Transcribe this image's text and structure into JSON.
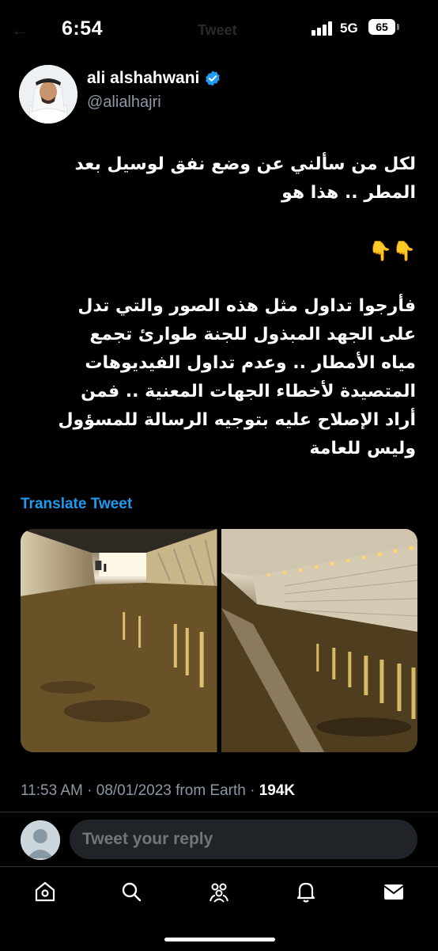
{
  "status_bar": {
    "time": "6:54",
    "network": "5G",
    "battery": "65",
    "header_ghost": "Tweet"
  },
  "author": {
    "name": "ali alshahwani",
    "handle": "@alialhajri",
    "verified": true
  },
  "tweet": {
    "paragraph1": [
      "لكل من سألني عن وضع نفق لوسيل بعد",
      "المطر .. هذا هو"
    ],
    "emoji": "👇👇",
    "paragraph2": [
      "فأرجوا تداول مثل هذه الصور والتي تدل",
      "على الجهد المبذول للجنة طوارئ تجمع",
      "مياه الأمطار .. وعدم تداول الفيديوهات",
      "المتصيدة لأخطاء الجهات المعنية .. فمن",
      "أراد الإصلاح عليه بتوجيه الرسالة للمسؤول",
      "وليس للعامة"
    ],
    "translate": "Translate Tweet",
    "media": [
      {
        "name": "tunnel-photo-left",
        "description": "flooded tunnel, lit ceiling"
      },
      {
        "name": "tunnel-photo-right",
        "description": "wet tunnel roadway with lights"
      }
    ],
    "meta": {
      "time": "11:53 AM",
      "date": "08/01/2023",
      "source": "from Earth",
      "views": "194K"
    }
  },
  "reply": {
    "placeholder": "Tweet your reply"
  },
  "tabs": [
    {
      "name": "home",
      "icon": "home-icon"
    },
    {
      "name": "search",
      "icon": "search-icon"
    },
    {
      "name": "communities",
      "icon": "communities-icon"
    },
    {
      "name": "notifications",
      "icon": "bell-icon"
    },
    {
      "name": "messages",
      "icon": "mail-icon"
    }
  ],
  "colors": {
    "accent": "#1d9bf0",
    "muted": "#8b98a5",
    "background": "#000000"
  }
}
